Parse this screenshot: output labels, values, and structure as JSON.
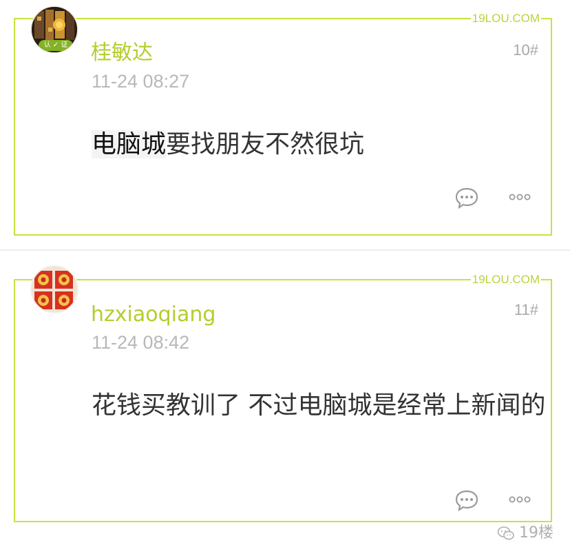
{
  "site_label": "19LOU.COM",
  "posts": [
    {
      "username": "桂敏达",
      "floor": "10#",
      "time": "11-24 08:27",
      "content_highlight": "电脑城",
      "content_rest": "要找朋友不然很坑",
      "badge": "认 ✓ 证"
    },
    {
      "username": "hzxiaoqiang",
      "floor": "11#",
      "time": "11-24 08:42",
      "content_highlight": "",
      "content_rest": "花钱买教训了 不过电脑城是经常上新闻的",
      "badge": ""
    }
  ],
  "watermark": "19楼",
  "colors": {
    "accent": "#cbe03f",
    "username": "#b6cc2e",
    "muted": "#b8b8b8",
    "text": "#333333"
  },
  "icons": {
    "comment": "comment-bubble-icon",
    "more": "more-dots-icon",
    "wechat": "wechat-icon"
  }
}
